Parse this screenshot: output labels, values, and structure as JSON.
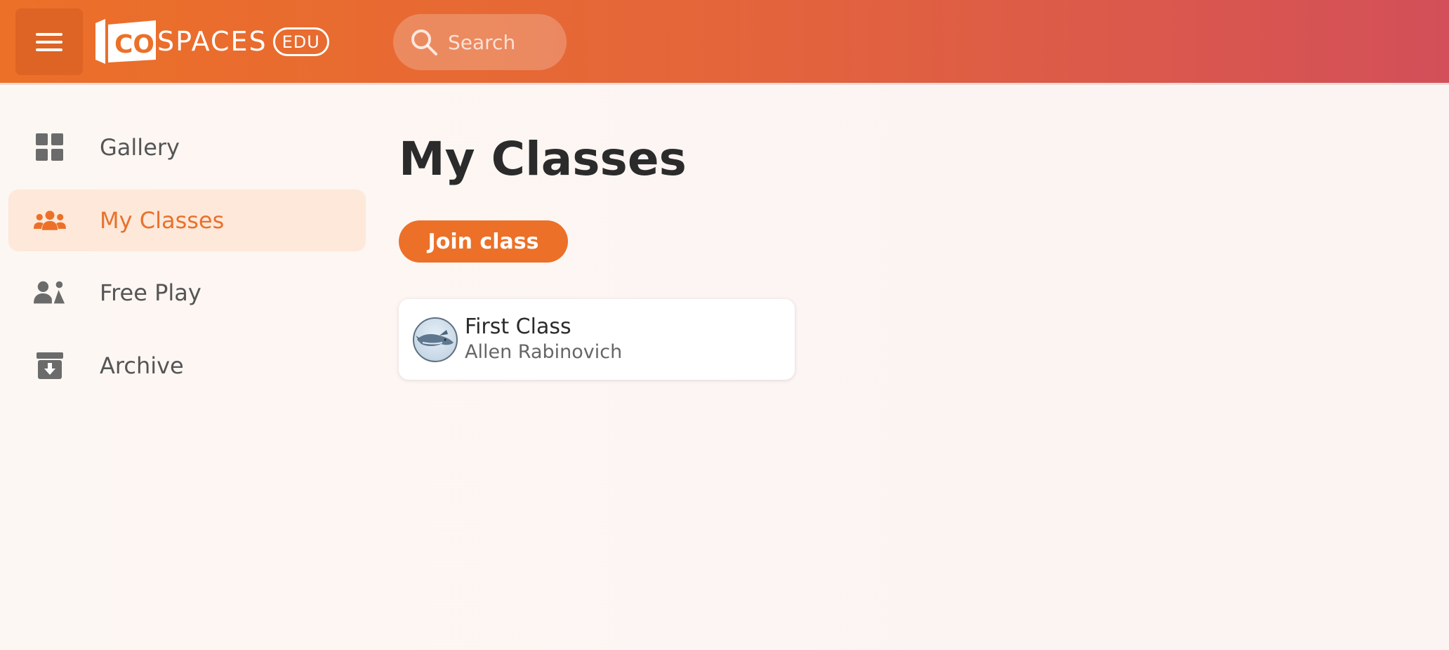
{
  "header": {
    "logo": {
      "prefix": "CO",
      "text": "SPACES",
      "badge": "EDU"
    },
    "search": {
      "placeholder": "Search"
    },
    "menu_icon": "hamburger-icon"
  },
  "sidebar": {
    "items": [
      {
        "label": "Gallery",
        "icon": "grid-icon",
        "active": false
      },
      {
        "label": "My Classes",
        "icon": "group-icon",
        "active": true
      },
      {
        "label": "Free Play",
        "icon": "user-shapes-icon",
        "active": false
      },
      {
        "label": "Archive",
        "icon": "archive-icon",
        "active": false
      }
    ]
  },
  "main": {
    "title": "My Classes",
    "join_label": "Join class",
    "classes": [
      {
        "name": "First Class",
        "owner": "Allen Rabinovich",
        "avatar_icon": "whale-avatar"
      }
    ]
  },
  "colors": {
    "accent": "#ec7028",
    "header_end": "#d34f59",
    "active_bg": "#fde8da",
    "nav_icon": "#6b6b6b"
  }
}
